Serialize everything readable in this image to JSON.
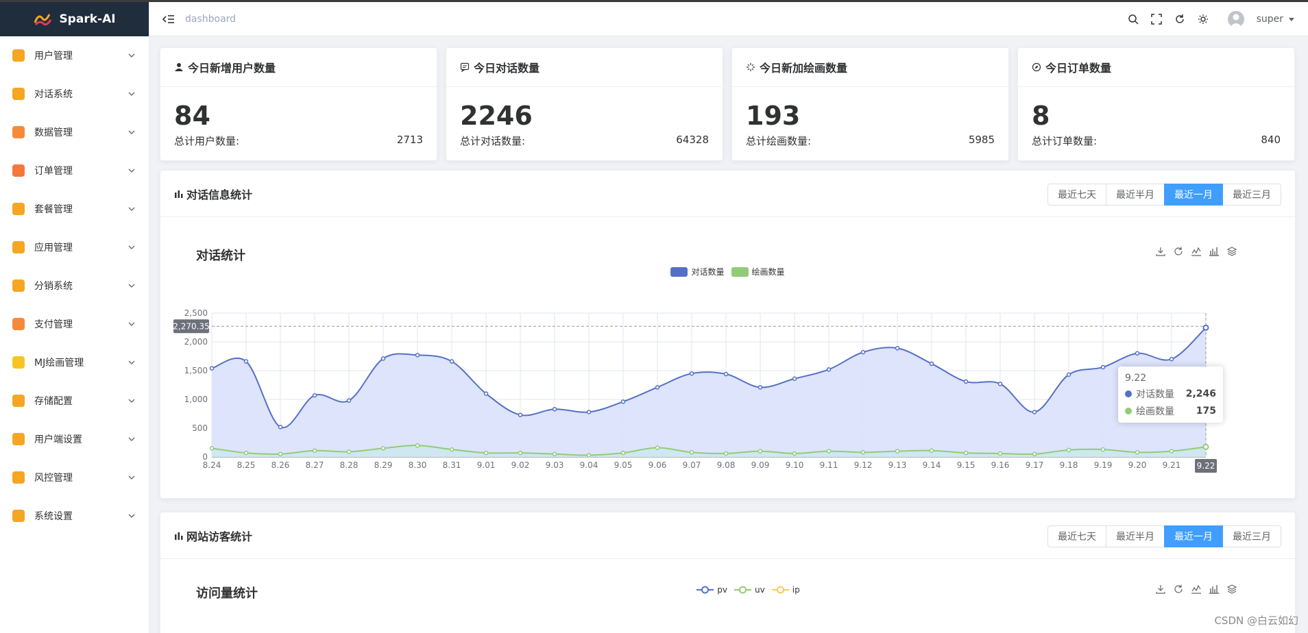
{
  "app": {
    "name": "Spark-AI"
  },
  "header": {
    "breadcrumb": "dashboard",
    "user": "super"
  },
  "sidebar": {
    "items": [
      {
        "label": "用户管理",
        "color": "#f5a623",
        "icon": "user-manage-icon"
      },
      {
        "label": "对话系统",
        "color": "#f5a623",
        "icon": "chat-system-icon"
      },
      {
        "label": "数据管理",
        "color": "#f58a3c",
        "icon": "data-manage-icon"
      },
      {
        "label": "订单管理",
        "color": "#f5773c",
        "icon": "order-manage-icon"
      },
      {
        "label": "套餐管理",
        "color": "#f5a623",
        "icon": "package-manage-icon"
      },
      {
        "label": "应用管理",
        "color": "#f5a623",
        "icon": "app-manage-icon"
      },
      {
        "label": "分销系统",
        "color": "#f5a623",
        "icon": "distribution-icon"
      },
      {
        "label": "支付管理",
        "color": "#f58a3c",
        "icon": "payment-icon"
      },
      {
        "label": "MJ绘画管理",
        "color": "#f5c623",
        "icon": "palette-icon"
      },
      {
        "label": "存储配置",
        "color": "#f5a623",
        "icon": "storage-icon"
      },
      {
        "label": "用户端设置",
        "color": "#f5a623",
        "icon": "client-settings-icon"
      },
      {
        "label": "风控管理",
        "color": "#f5a623",
        "icon": "shield-icon"
      },
      {
        "label": "系统设置",
        "color": "#f5a623",
        "icon": "gear-icon"
      }
    ]
  },
  "stats": [
    {
      "title": "今日新增用户数量",
      "value": "84",
      "total_label": "总计用户数量:",
      "total": "2713",
      "icon": "user-icon"
    },
    {
      "title": "今日对话数量",
      "value": "2246",
      "total_label": "总计对话数量:",
      "total": "64328",
      "icon": "message-icon"
    },
    {
      "title": "今日新加绘画数量",
      "value": "193",
      "total_label": "总计绘画数量:",
      "total": "5985",
      "icon": "sparkle-icon"
    },
    {
      "title": "今日订单数量",
      "value": "8",
      "total_label": "总计订单数量:",
      "total": "840",
      "icon": "compass-icon"
    }
  ],
  "panel1": {
    "title": "对话信息统计",
    "ranges": [
      "最近七天",
      "最近半月",
      "最近一月",
      "最近三月"
    ],
    "active_range": "最近一月",
    "chart_title": "对话统计"
  },
  "panel2": {
    "title": "网站访客统计",
    "ranges": [
      "最近七天",
      "最近半月",
      "最近一月",
      "最近三月"
    ],
    "active_range": "最近一月",
    "chart_title": "访问量统计",
    "legend": [
      {
        "name": "pv",
        "color": "#5470c6"
      },
      {
        "name": "uv",
        "color": "#91cc75"
      },
      {
        "name": "ip",
        "color": "#fac858"
      }
    ]
  },
  "tooltip": {
    "date": "9.22",
    "rows": [
      {
        "name": "对话数量",
        "value": "2,246",
        "color": "#5470c6"
      },
      {
        "name": "绘画数量",
        "value": "175",
        "color": "#91cc75"
      }
    ]
  },
  "axis_pointer": {
    "y_label": "2,270.35",
    "x_label": "9.22"
  },
  "watermark": "CSDN @白云如幻",
  "chart_data": {
    "type": "area",
    "title": "对话统计",
    "xlabel": "",
    "ylabel": "",
    "ylim": [
      0,
      2500
    ],
    "yticks": [
      "0",
      "500",
      "1,000",
      "1,500",
      "2,000",
      "2,500"
    ],
    "grid": true,
    "legend_position": "top-center",
    "categories": [
      "8.24",
      "8.25",
      "8.26",
      "8.27",
      "8.28",
      "8.29",
      "8.30",
      "8.31",
      "9.01",
      "9.02",
      "9.03",
      "9.04",
      "9.05",
      "9.06",
      "9.07",
      "9.08",
      "9.09",
      "9.10",
      "9.11",
      "9.12",
      "9.13",
      "9.14",
      "9.15",
      "9.16",
      "9.17",
      "9.18",
      "9.19",
      "9.20",
      "9.21",
      "9.22"
    ],
    "series": [
      {
        "name": "对话数量",
        "color": "#5470c6",
        "fill": "#dbe3fb",
        "values": [
          1540,
          1660,
          520,
          1070,
          980,
          1710,
          1770,
          1660,
          1100,
          730,
          830,
          780,
          960,
          1210,
          1450,
          1440,
          1210,
          1360,
          1520,
          1820,
          1890,
          1620,
          1310,
          1270,
          780,
          1430,
          1560,
          1800,
          1700,
          2246
        ]
      },
      {
        "name": "绘画数量",
        "color": "#91cc75",
        "fill": "#cde7ef",
        "values": [
          150,
          70,
          50,
          110,
          90,
          150,
          200,
          130,
          70,
          70,
          50,
          30,
          70,
          160,
          80,
          60,
          100,
          60,
          100,
          80,
          100,
          110,
          70,
          60,
          50,
          120,
          130,
          80,
          100,
          175
        ]
      }
    ]
  }
}
